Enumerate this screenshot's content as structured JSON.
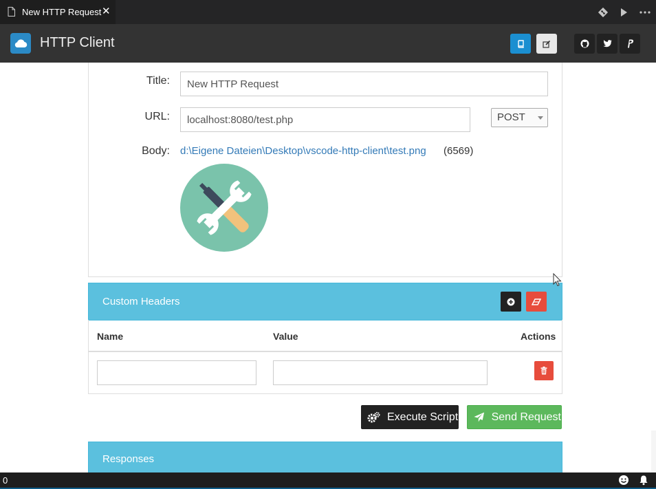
{
  "tab": {
    "label": "New HTTP Request",
    "close_glyph": "✕"
  },
  "tab_actions": [
    {
      "icon": "git-compare-icon"
    },
    {
      "icon": "run-icon"
    },
    {
      "icon": "more-icon"
    }
  ],
  "header": {
    "title": "HTTP Client",
    "logo_icon": "cloud-icon",
    "buttons": [
      {
        "icon": "book-icon"
      },
      {
        "icon": "edit-icon"
      },
      {
        "icon": "github-icon"
      },
      {
        "icon": "twitter-icon"
      },
      {
        "icon": "paypal-icon"
      }
    ]
  },
  "form": {
    "title_label": "Title:",
    "title_value": "New HTTP Request",
    "url_label": "URL:",
    "url_value": "localhost:8080/test.php",
    "method": "POST",
    "body_label": "Body:",
    "body_file": "d:\\Eigene Dateien\\Desktop\\vscode-http-client\\test.png",
    "body_size": "(6569)",
    "body_image_icon": "tools-icon"
  },
  "custom_headers": {
    "title": "Custom Headers",
    "columns": {
      "name": "Name",
      "value": "Value",
      "actions": "Actions"
    },
    "rows": [
      {
        "name": "",
        "value": ""
      }
    ]
  },
  "actions": {
    "execute_label": "Execute Script",
    "send_label": "Send Request"
  },
  "responses": {
    "title": "Responses"
  },
  "statusbar": {
    "count": "0"
  },
  "colors": {
    "panel_header": "#5bc0de",
    "send_green": "#5cb85c",
    "danger_red": "#e74c3c",
    "link_blue": "#337ab7"
  }
}
